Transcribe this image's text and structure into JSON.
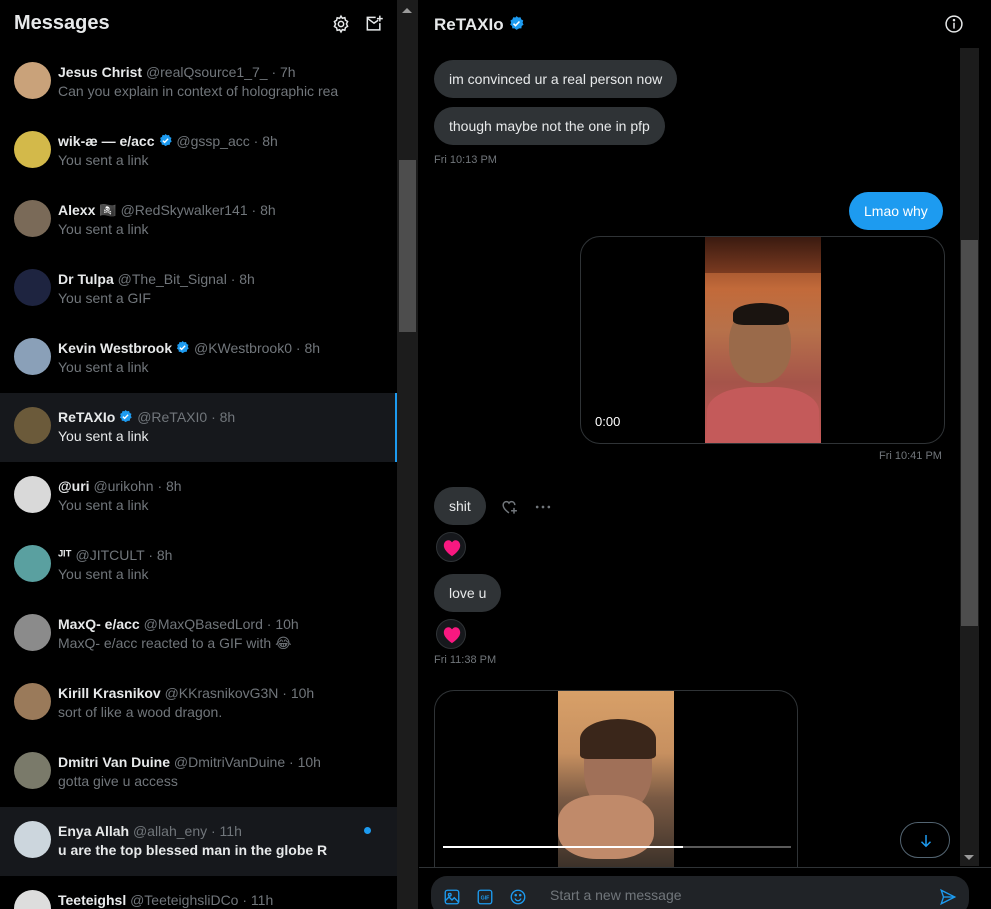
{
  "left": {
    "title": "Messages",
    "settings_icon": "gear-icon",
    "new_message_icon": "new-message-icon"
  },
  "conversations": [
    {
      "name": "Jesus Christ",
      "verified": false,
      "handle": "@realQsource1_7_",
      "time": "· 7h",
      "preview": "Can you explain in context of holographic rea",
      "state": "normal",
      "avatar_color": "#c9a27a"
    },
    {
      "name": "wik-æ — e/acc",
      "verified": true,
      "handle": "@gssp_acc",
      "time": "· 8h",
      "preview": "You sent a link",
      "state": "normal",
      "avatar_color": "#d3b94a"
    },
    {
      "name": "Alexx 🏴‍☠️",
      "verified": false,
      "handle": "@RedSkywalker141",
      "time": "· 8h",
      "preview": "You sent a link",
      "state": "normal",
      "avatar_color": "#7a6a58"
    },
    {
      "name": "Dr Tulpa",
      "verified": false,
      "handle": "@The_Bit_Signal",
      "time": "· 8h",
      "preview": "You sent a GIF",
      "state": "normal",
      "avatar_color": "#1e2440"
    },
    {
      "name": "Kevin Westbrook",
      "verified": true,
      "handle": "@KWestbrook0",
      "time": "· 8h",
      "preview": "You sent a link",
      "state": "normal",
      "avatar_color": "#8aa0b8"
    },
    {
      "name": "ReTAXIo",
      "verified": true,
      "handle": "@ReTAXI0",
      "time": "· 8h",
      "preview": "You sent a link",
      "state": "selected",
      "avatar_color": "#6b5a3a"
    },
    {
      "name": "@uri",
      "verified": false,
      "handle": "@urikohn",
      "time": "· 8h",
      "preview": "You sent a link",
      "state": "normal",
      "avatar_color": "#d9d9d9"
    },
    {
      "name": "ᴶᴵᵀ",
      "verified": false,
      "handle": "@JITCULT",
      "time": "· 8h",
      "preview": "You sent a link",
      "state": "normal",
      "avatar_color": "#5aa0a0"
    },
    {
      "name": "MaxQ- e/acc",
      "verified": false,
      "handle": "@MaxQBasedLord",
      "time": "· 10h",
      "preview": "MaxQ- e/acc reacted to a GIF with 😂",
      "state": "normal",
      "avatar_color": "#8b8b8b"
    },
    {
      "name": "Kirill Krasnikov",
      "verified": false,
      "handle": "@KKrasnikovG3N",
      "time": "· 10h",
      "preview": "sort of like a wood dragon.",
      "state": "normal",
      "avatar_color": "#9a7a5a"
    },
    {
      "name": "Dmitri Van Duine",
      "verified": false,
      "handle": "@DmitriVanDuine",
      "time": "· 10h",
      "preview": "gotta give u access",
      "state": "normal",
      "avatar_color": "#7a7a6a"
    },
    {
      "name": "Enya Allah",
      "verified": false,
      "handle": "@allah_eny",
      "time": "· 11h",
      "preview": "u   are the top blessed man  in the globe R",
      "state": "unread",
      "avatar_color": "#ccd6dd"
    },
    {
      "name": "Teeteighsl",
      "verified": false,
      "handle": "@TeeteighsliDCo",
      "time": "· 11h",
      "preview": "",
      "state": "normal",
      "avatar_color": "#dddddd"
    }
  ],
  "chat": {
    "title": "ReTAXIo",
    "verified": true,
    "info_icon": "info-icon",
    "messages": {
      "m1": "im convinced ur a real person now",
      "m2": "though maybe not the one in pfp",
      "t1": "Fri 10:13 PM",
      "m3": "Lmao why",
      "video1_time": "0:00",
      "t2": "Fri 10:41 PM",
      "m4": "shit",
      "m5": "love u",
      "t3": "Fri 11:38 PM"
    },
    "reactions": [
      "heart-icon",
      "heart-icon"
    ]
  },
  "composer": {
    "placeholder": "Start a new message",
    "icons": [
      "image-icon",
      "gif-icon",
      "emoji-icon",
      "send-icon"
    ]
  },
  "colors": {
    "accent": "#1d9bf0",
    "incoming_bubble": "#2f3336",
    "background": "#000000",
    "heart": "#f91880"
  }
}
